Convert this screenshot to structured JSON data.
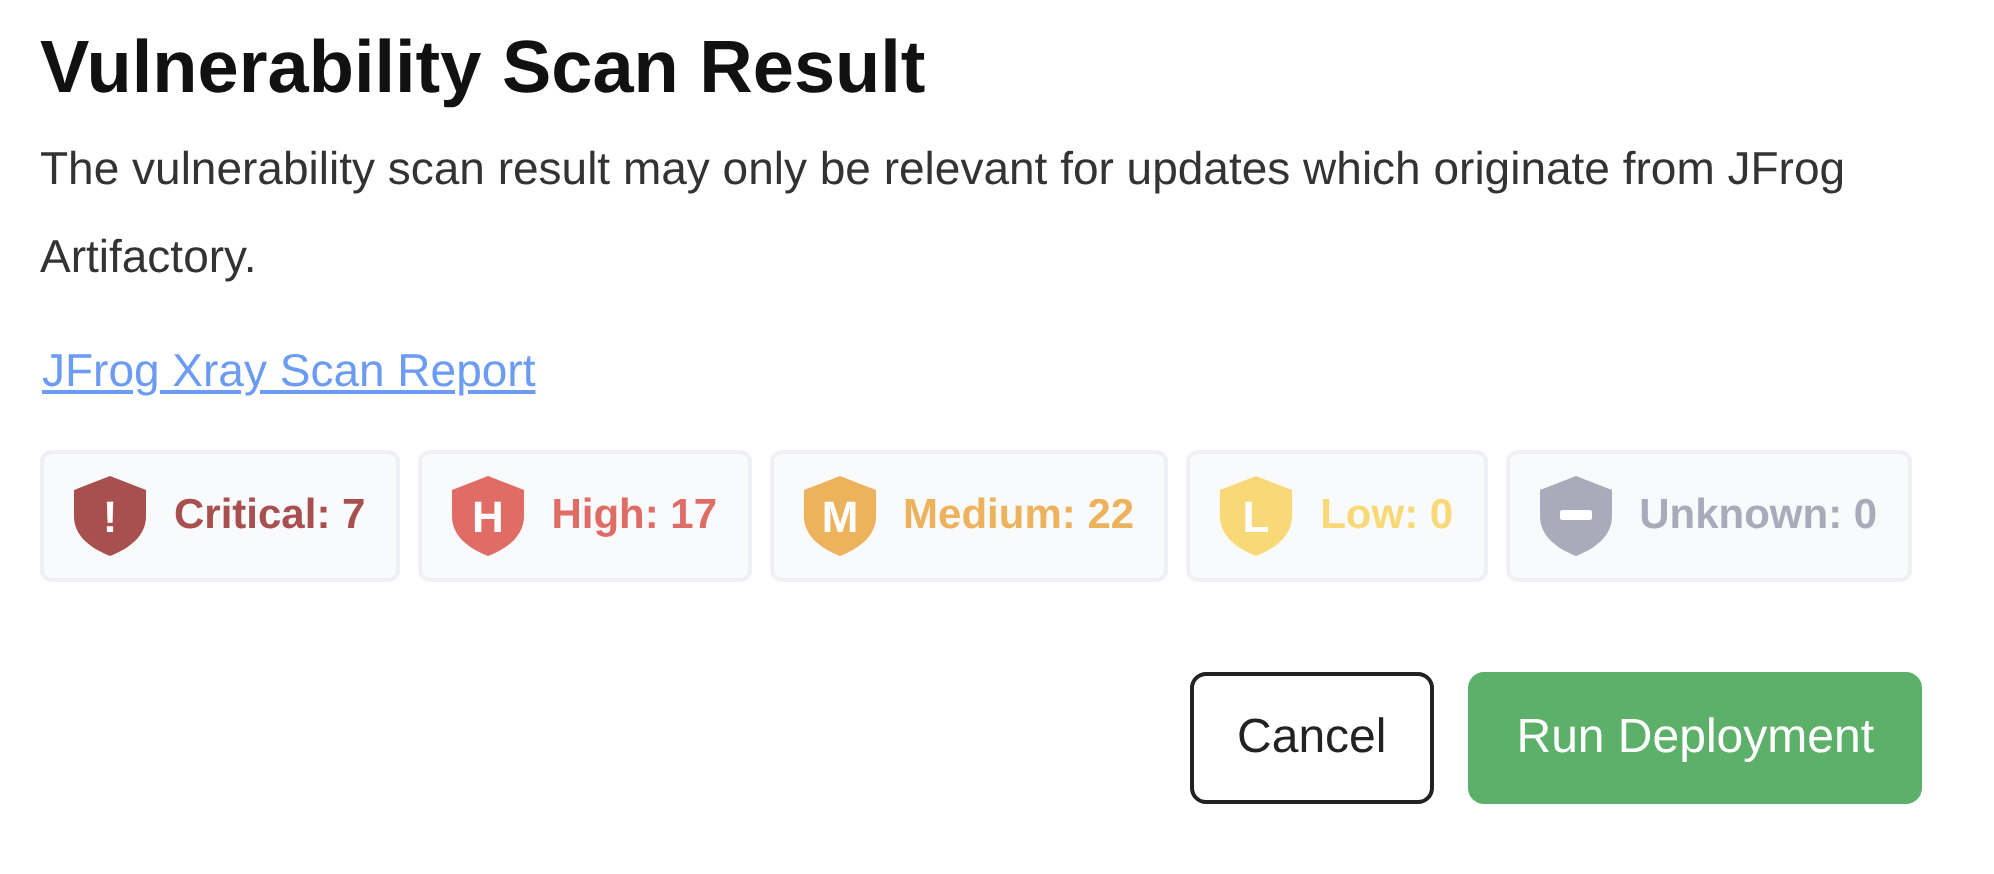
{
  "title": "Vulnerability Scan Result",
  "description": "The vulnerability scan result may only be relevant for updates which originate from JFrog Artifactory.",
  "link": "JFrog Xray Scan Report",
  "severities": [
    {
      "kind": "letter",
      "symbol": "!",
      "label": "Critical: 7",
      "color": "#a84f4f"
    },
    {
      "kind": "letter",
      "symbol": "H",
      "label": "High: 17",
      "color": "#e06c66"
    },
    {
      "kind": "letter",
      "symbol": "M",
      "label": "Medium: 22",
      "color": "#edb25c"
    },
    {
      "kind": "letter",
      "symbol": "L",
      "label": "Low: 0",
      "color": "#f9d977"
    },
    {
      "kind": "dash",
      "label": "Unknown: 0",
      "color": "#a9abba"
    }
  ],
  "buttons": [
    {
      "label": "Cancel",
      "kind": "secondary"
    },
    {
      "label": "Run Deployment",
      "kind": "primary"
    }
  ]
}
